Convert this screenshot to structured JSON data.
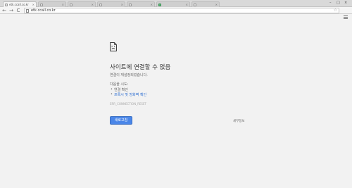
{
  "tabs": [
    {
      "label": "etk.ccall.co.kr",
      "active": true
    },
    {
      "label": "",
      "active": false
    },
    {
      "label": "",
      "active": false
    },
    {
      "label": "",
      "active": false
    },
    {
      "label": "",
      "active": false
    },
    {
      "label": "",
      "active": false
    },
    {
      "label": "",
      "active": false
    }
  ],
  "window_controls": {
    "minimize": "–",
    "maximize": "□",
    "close": "×"
  },
  "toolbar": {
    "back_icon": "←",
    "forward_icon": "→",
    "reload_icon": "C",
    "url": "etk.ccall.co.kr",
    "star_icon": "☆"
  },
  "error": {
    "title": "사이트에 연결할 수 없음",
    "subtitle": "연결이 재설정되었습니다.",
    "try_label": "다음을 시도:",
    "suggestions": [
      "연결 확인",
      "프록시 및 방화벽 확인"
    ],
    "code": "ERR_CONNECTION_RESET",
    "reload_label": "새로고침",
    "details_label": "세부정보"
  },
  "colors": {
    "accent": "#4a86e8",
    "link": "#2f6fd1",
    "page_bg": "#f2f2f2"
  }
}
